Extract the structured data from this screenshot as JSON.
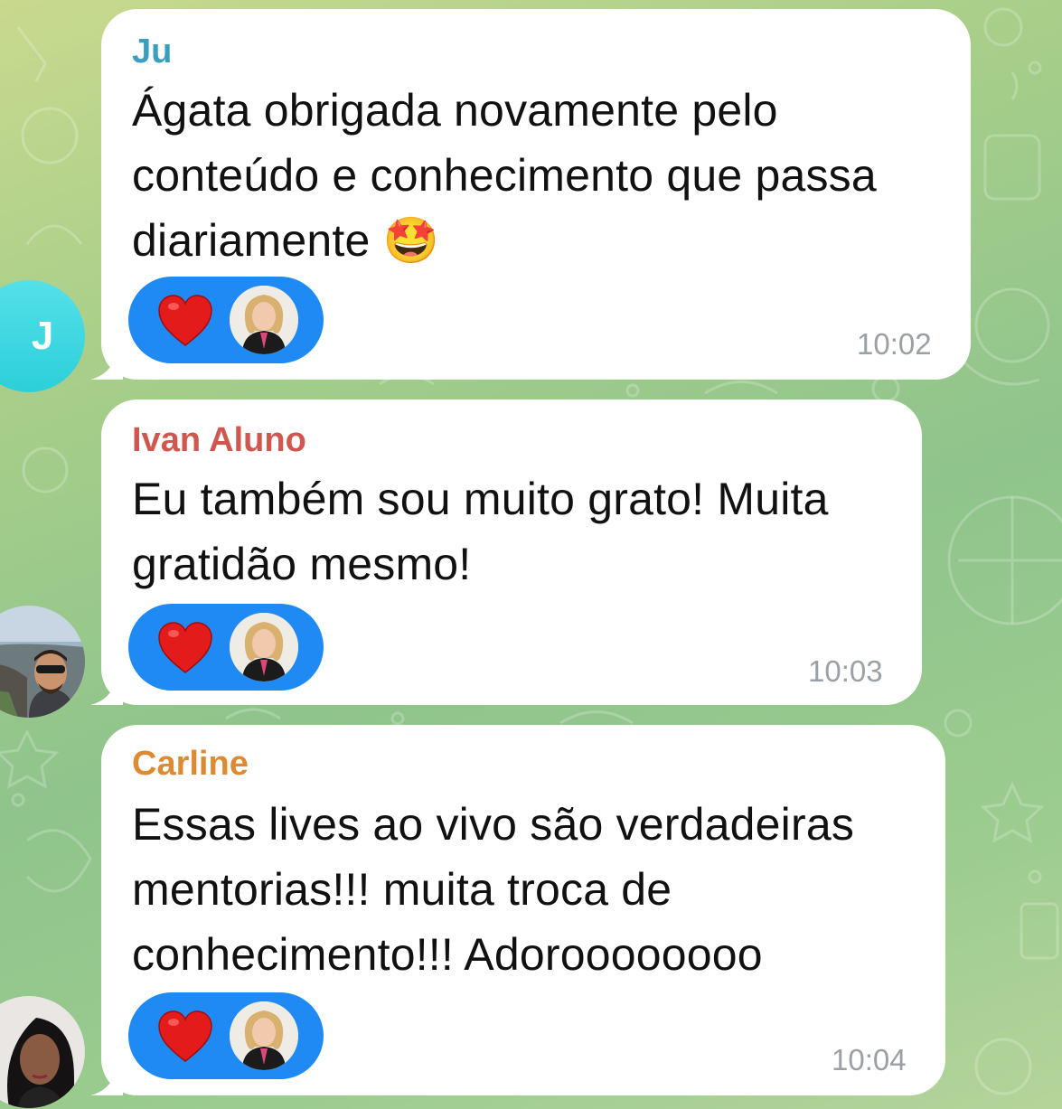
{
  "colors": {
    "background": "#9cc98d",
    "bubble": "#ffffff",
    "reaction_pill": "#1f8af3",
    "timestamp": "#9aa0a6"
  },
  "messages": [
    {
      "sender": "Ju",
      "sender_color": "#3a9fbf",
      "lines": [
        "Ágata obrigada novamente pelo",
        "conteúdo e conhecimento que passa",
        "diariamente 🤩"
      ],
      "reaction": "heart-icon",
      "time": "10:02",
      "avatar_initial": "J"
    },
    {
      "sender": "Ivan Aluno",
      "sender_color": "#d0574f",
      "lines": [
        "Eu também sou muito grato! Muita",
        "gratidão mesmo!"
      ],
      "reaction": "heart-icon",
      "time": "10:03"
    },
    {
      "sender": "Carline",
      "sender_color": "#dd8a32",
      "lines": [
        "Essas lives ao  vivo são verdadeiras",
        "mentorias!!! muita troca de",
        "conhecimento!!! Adoroooooooo"
      ],
      "reaction": "heart-icon",
      "time": "10:04"
    }
  ]
}
